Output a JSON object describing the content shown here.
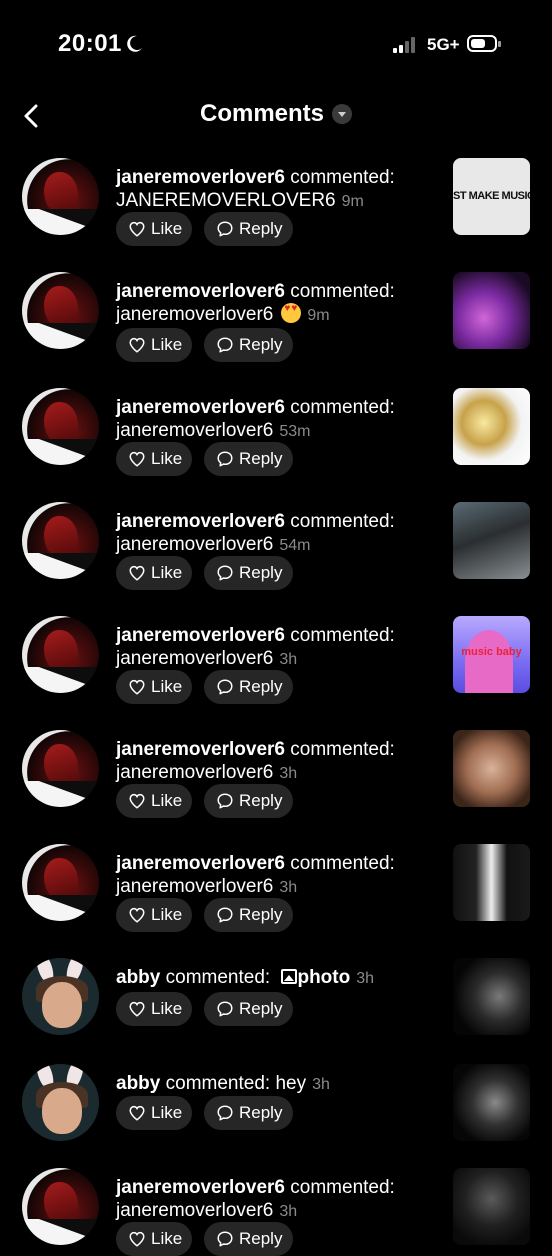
{
  "status_bar": {
    "time": "20:01",
    "network": "5G+"
  },
  "header": {
    "title": "Comments"
  },
  "buttons": {
    "like": "Like",
    "reply": "Reply"
  },
  "comments": [
    {
      "user": "janeremoverlover6",
      "verb": "commented:",
      "text": "JANEREMOVERLOVER6",
      "time": "9m",
      "thumb_text": "ST MAKE MUSIC"
    },
    {
      "user": "janeremoverlover6",
      "verb": "commented:",
      "text": "janeremoverlover6",
      "time": "9m",
      "emoji": "heart-eyes-emoji"
    },
    {
      "user": "janeremoverlover6",
      "verb": "commented:",
      "text": "janeremoverlover6",
      "time": "53m"
    },
    {
      "user": "janeremoverlover6",
      "verb": "commented:",
      "text": "janeremoverlover6",
      "time": "54m"
    },
    {
      "user": "janeremoverlover6",
      "verb": "commented:",
      "text": "janeremoverlover6",
      "time": "3h",
      "thumb_text": "music baby"
    },
    {
      "user": "janeremoverlover6",
      "verb": "commented:",
      "text": "janeremoverlover6",
      "time": "3h"
    },
    {
      "user": "janeremoverlover6",
      "verb": "commented:",
      "text": "janeremoverlover6",
      "time": "3h"
    },
    {
      "user": "abby",
      "verb": "commented:",
      "text": "photo",
      "time": "3h"
    },
    {
      "user": "abby",
      "verb": "commented:",
      "text": "hey",
      "time": "3h"
    },
    {
      "user": "janeremoverlover6",
      "verb": "commented:",
      "text": "janeremoverlover6",
      "time": "3h"
    }
  ]
}
